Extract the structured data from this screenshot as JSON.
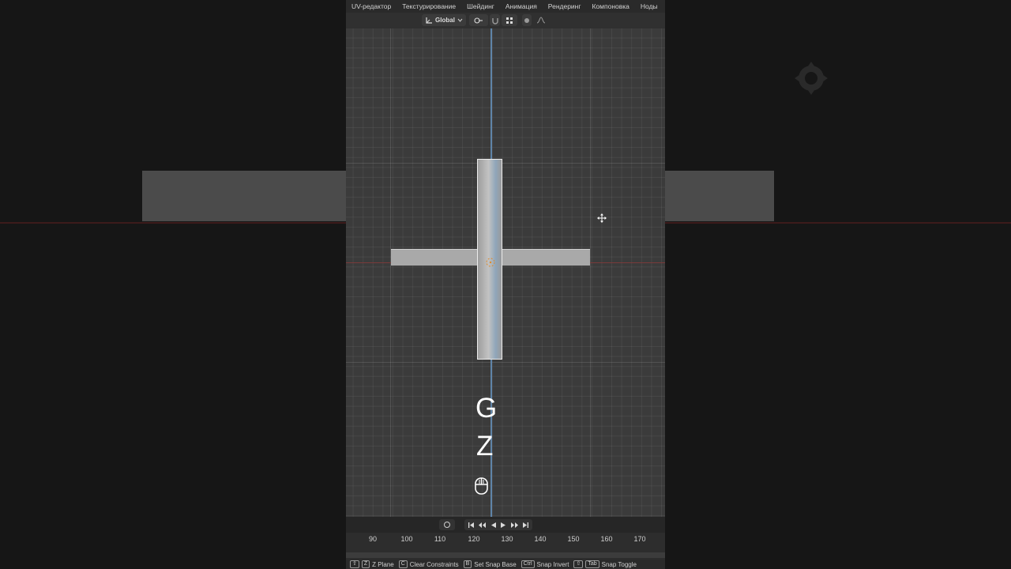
{
  "topbar": {
    "workspace_tabs": [
      "UV-редактор",
      "Текстурирование",
      "Шейдинг",
      "Анимация",
      "Рендеринг",
      "Компоновка",
      "Ноды"
    ]
  },
  "header": {
    "transform_orientation": "Global",
    "icons": [
      "orientation-icon",
      "chevron-down-icon",
      "link-icon",
      "snap-icon",
      "grid-snap-icon",
      "proportional-edit-icon",
      "falloff-icon"
    ]
  },
  "viewport": {
    "key_overlay": [
      "G",
      "Z"
    ],
    "mouse_hint": "mouse-icon",
    "axis_colors": {
      "y_axis": "#5f84a8",
      "x_axis": "#7a3a3a"
    }
  },
  "timeline": {
    "frame_ticks": [
      "90",
      "100",
      "110",
      "120",
      "130",
      "140",
      "150",
      "160",
      "170"
    ],
    "controls": [
      "record-icon",
      "jump-start-icon",
      "prev-keyframe-icon",
      "play-reverse-icon",
      "play-icon",
      "next-keyframe-icon",
      "jump-end-icon"
    ]
  },
  "statusbar": {
    "items": [
      {
        "keys": [
          "⇧",
          "Z"
        ],
        "label": "Z Plane"
      },
      {
        "keys": [
          "C"
        ],
        "label": "Clear Constraints"
      },
      {
        "keys": [
          "B"
        ],
        "label": "Set Snap Base"
      },
      {
        "keys": [
          "Ctrl"
        ],
        "label": "Snap Invert"
      },
      {
        "keys": [
          "⇧",
          "Tab"
        ],
        "label": "Snap Toggle"
      }
    ]
  }
}
